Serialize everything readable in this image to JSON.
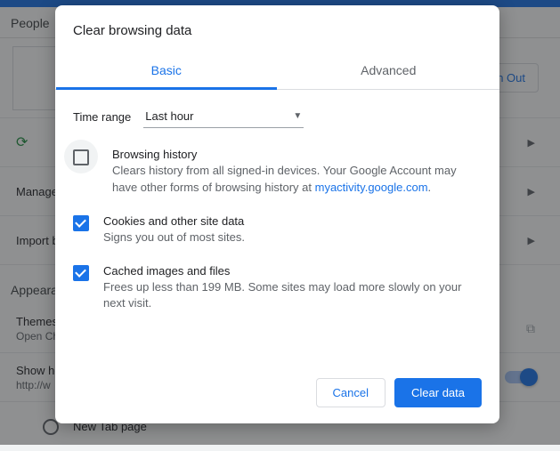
{
  "bg": {
    "people_title": "People",
    "signout": "n Out",
    "rows": {
      "sync": "",
      "manage": "Manage",
      "import": "Import b"
    },
    "appearance_title": "Appearance",
    "themes_label": "Themes",
    "themes_sub": "Open Ch",
    "showhome_label": "Show ho",
    "showhome_sub": "http://w",
    "newtab_label": "New Tab page"
  },
  "dialog": {
    "title": "Clear browsing data",
    "tabs": {
      "basic": "Basic",
      "advanced": "Advanced"
    },
    "time_label": "Time range",
    "time_value": "Last hour",
    "options": [
      {
        "checked": false,
        "ringed": true,
        "title": "Browsing history",
        "desc_pre": "Clears history from all signed-in devices. Your Google Account may have other forms of browsing history at ",
        "link": "myactivity.google.com",
        "desc_post": "."
      },
      {
        "checked": true,
        "ringed": false,
        "title": "Cookies and other site data",
        "desc_pre": "Signs you out of most sites.",
        "link": "",
        "desc_post": ""
      },
      {
        "checked": true,
        "ringed": false,
        "title": "Cached images and files",
        "desc_pre": "Frees up less than 199 MB. Some sites may load more slowly on your next visit.",
        "link": "",
        "desc_post": ""
      }
    ],
    "cancel": "Cancel",
    "clear": "Clear data"
  }
}
